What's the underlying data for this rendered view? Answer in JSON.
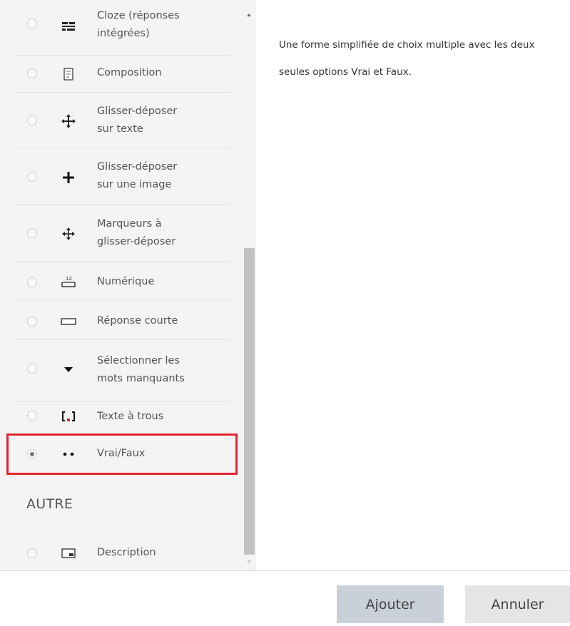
{
  "question_types": [
    {
      "label": "Cloze (réponses intégrées)",
      "label_lines": [
        "Cloze (réponses",
        "intégrées)"
      ],
      "icon": "cloze-icon",
      "selected": false
    },
    {
      "label": "Composition",
      "label_lines": [
        "Composition"
      ],
      "icon": "essay-icon",
      "selected": false
    },
    {
      "label": "Glisser-déposer sur texte",
      "label_lines": [
        "Glisser-déposer",
        "sur texte"
      ],
      "icon": "drag-drop-text-icon",
      "selected": false
    },
    {
      "label": "Glisser-déposer sur une image",
      "label_lines": [
        "Glisser-déposer",
        "sur une image"
      ],
      "icon": "drag-drop-image-icon",
      "selected": false
    },
    {
      "label": "Marqueurs à glisser-déposer",
      "label_lines": [
        "Marqueurs à",
        "glisser-déposer"
      ],
      "icon": "drag-drop-markers-icon",
      "selected": false
    },
    {
      "label": "Numérique",
      "label_lines": [
        "Numérique"
      ],
      "icon": "numerical-icon",
      "selected": false
    },
    {
      "label": "Réponse courte",
      "label_lines": [
        "Réponse courte"
      ],
      "icon": "short-answer-icon",
      "selected": false
    },
    {
      "label": "Sélectionner les mots manquants",
      "label_lines": [
        "Sélectionner les",
        "mots manquants"
      ],
      "icon": "select-missing-words-icon",
      "selected": false
    },
    {
      "label": "Texte à trous",
      "label_lines": [
        "Texte à trous"
      ],
      "icon": "gap-text-icon",
      "selected": false
    },
    {
      "label": "Vrai/Faux",
      "label_lines": [
        "Vrai/Faux"
      ],
      "icon": "true-false-icon",
      "selected": true
    }
  ],
  "other_section": {
    "heading": "AUTRE",
    "items": [
      {
        "label": "Description",
        "label_lines": [
          "Description"
        ],
        "icon": "description-icon",
        "selected": false
      }
    ]
  },
  "selected_description": "Une forme simplifiée de choix multiple avec les deux seules options Vrai et Faux.",
  "buttons": {
    "add_label": "Ajouter",
    "cancel_label": "Annuler"
  },
  "colors": {
    "highlight": "#e0262f",
    "add_button": "#c9d0da",
    "cancel_button": "#e5e5e5",
    "panel_background": "#f4f4f4"
  }
}
